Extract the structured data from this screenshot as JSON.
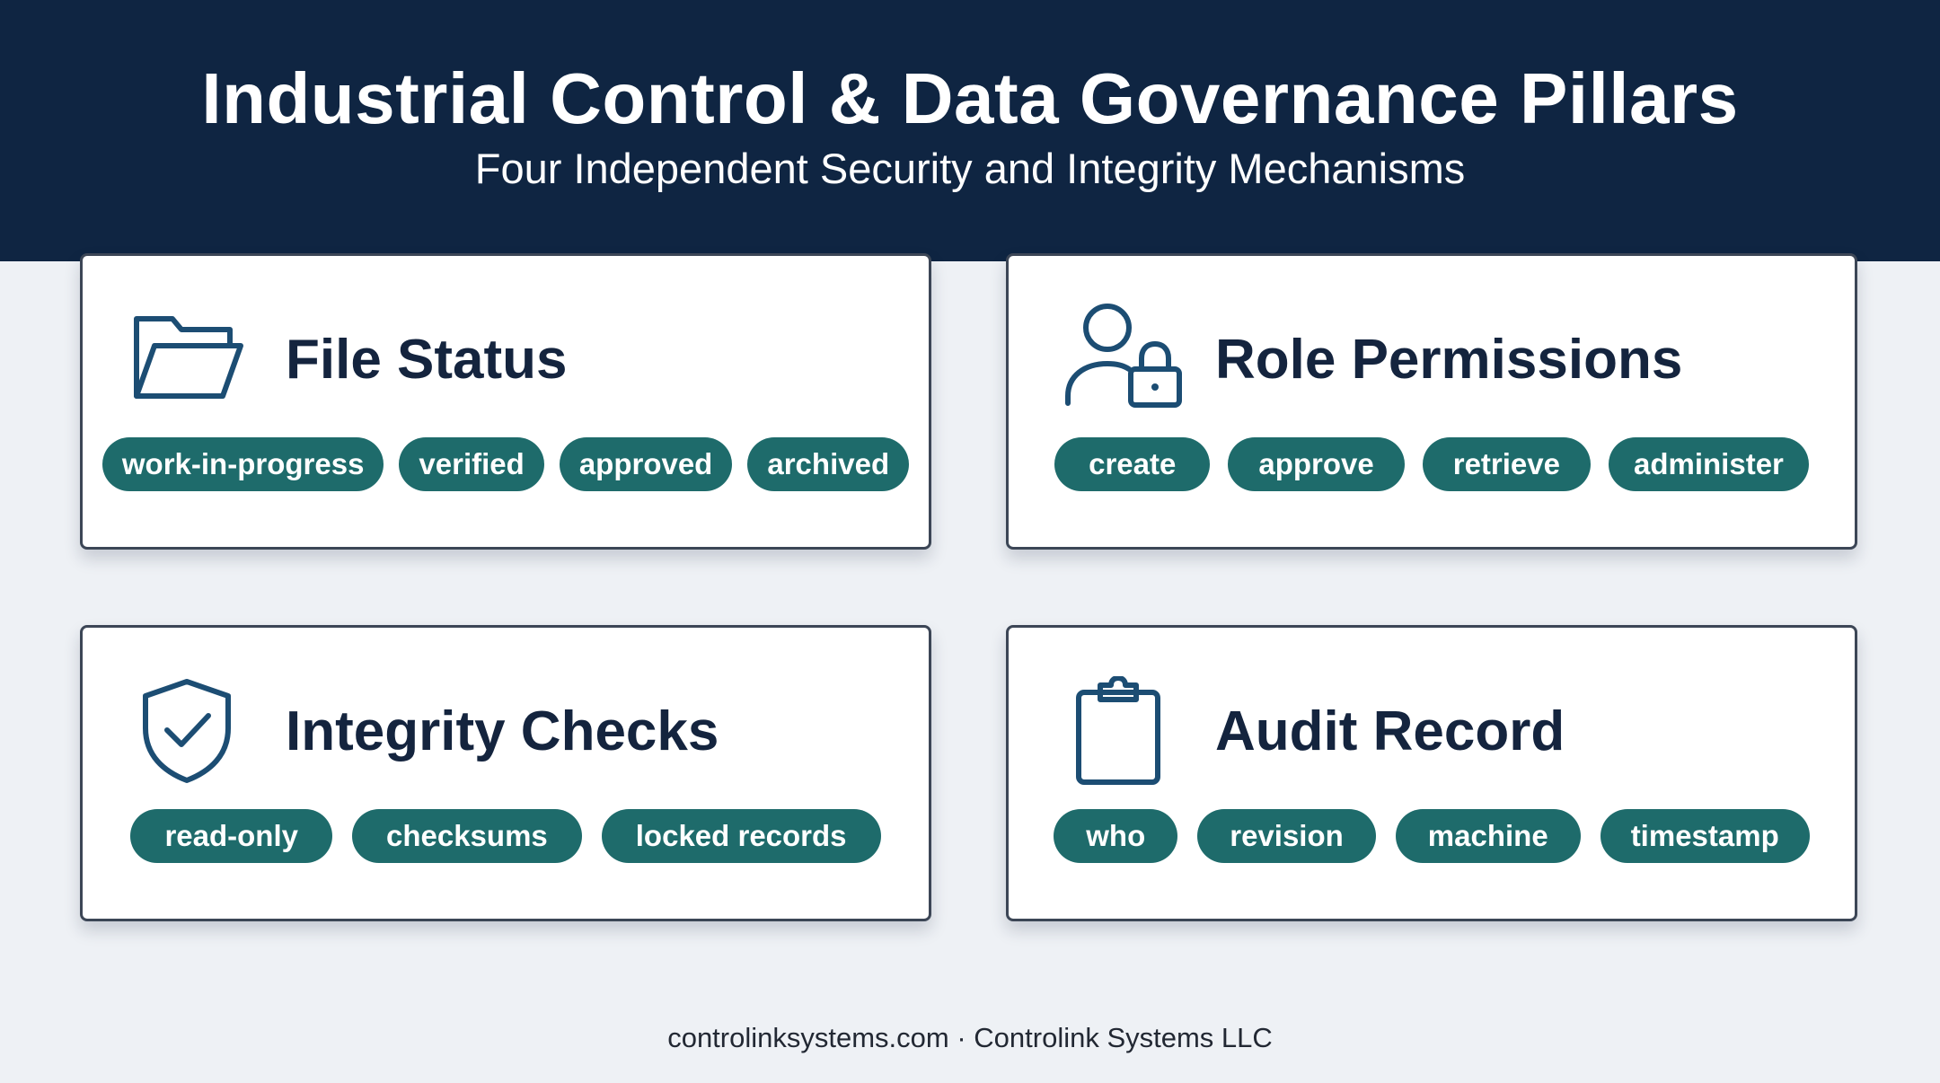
{
  "header": {
    "title": "Industrial Control & Data Governance Pillars",
    "subtitle": "Four Independent Security and Integrity Mechanisms"
  },
  "cards": [
    {
      "title": "File Status",
      "icon": "folder-icon",
      "tags": [
        "work-in-progress",
        "verified",
        "approved",
        "archived"
      ]
    },
    {
      "title": "Role Permissions",
      "icon": "user-lock-icon",
      "tags": [
        "create",
        "approve",
        "retrieve",
        "administer"
      ]
    },
    {
      "title": "Integrity Checks",
      "icon": "shield-check-icon",
      "tags": [
        "read-only",
        "checksums",
        "locked records"
      ]
    },
    {
      "title": "Audit Record",
      "icon": "clipboard-icon",
      "tags": [
        "who",
        "revision",
        "machine",
        "timestamp"
      ]
    }
  ],
  "footer": {
    "text": "controlinksystems.com · Controlink Systems LLC"
  },
  "colors": {
    "header_bg": "#0f2542",
    "page_bg": "#eef1f5",
    "pill_bg": "#1e6b6b",
    "title_text": "#14243e",
    "icon_stroke": "#1c4d73"
  }
}
